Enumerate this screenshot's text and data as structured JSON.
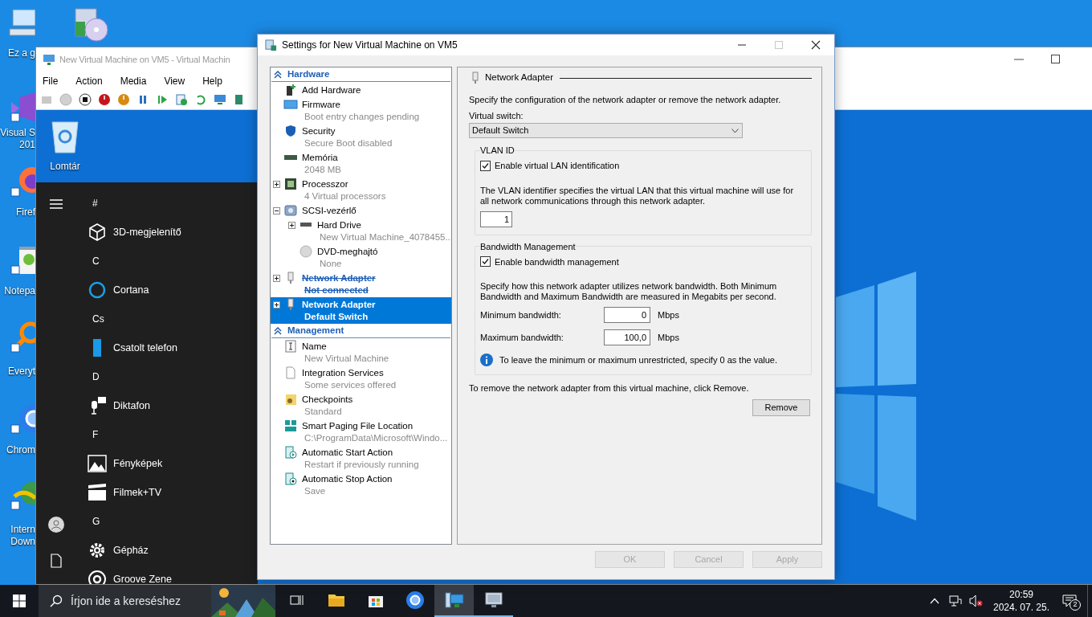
{
  "desktop": {
    "icons": [
      {
        "lines": [
          "Ez a g"
        ]
      },
      {
        "lines": [
          "Visual S",
          "201"
        ]
      },
      {
        "lines": [
          "Firef"
        ]
      },
      {
        "lines": [
          "Notepa"
        ]
      },
      {
        "lines": [
          "Everyt"
        ]
      },
      {
        "lines": [
          "Chrom"
        ]
      },
      {
        "lines": [
          "Intern",
          "Down"
        ]
      }
    ]
  },
  "vm_window": {
    "title": "New Virtual Machine on VM5 - Virtual Machin",
    "menu": [
      "File",
      "Action",
      "Media",
      "View",
      "Help"
    ],
    "guest": {
      "recycle_bin": "Lomtár",
      "start_menu": {
        "items": [
          {
            "kind": "header",
            "label": "#"
          },
          {
            "kind": "app",
            "label": "3D-megjelenítő"
          },
          {
            "kind": "header",
            "label": "C"
          },
          {
            "kind": "app",
            "label": "Cortana"
          },
          {
            "kind": "header",
            "label": "Cs"
          },
          {
            "kind": "app",
            "label": "Csatolt telefon"
          },
          {
            "kind": "header",
            "label": "D"
          },
          {
            "kind": "app",
            "label": "Diktafon"
          },
          {
            "kind": "header",
            "label": "F"
          },
          {
            "kind": "app",
            "label": "Fényképek"
          },
          {
            "kind": "app",
            "label": "Filmek+TV"
          },
          {
            "kind": "header",
            "label": "G"
          },
          {
            "kind": "app",
            "label": "Gépház"
          },
          {
            "kind": "app",
            "label": "Groove Zene"
          }
        ]
      }
    }
  },
  "settings": {
    "title": "Settings for New Virtual Machine on VM5",
    "sections": [
      {
        "label": "Hardware",
        "expanded": true,
        "items": [
          {
            "label": "Add Hardware",
            "selected": false,
            "removed": false
          },
          {
            "label": "Firmware",
            "detail": "Boot entry changes pending",
            "selected": false,
            "removed": false
          },
          {
            "label": "Security",
            "detail": "Secure Boot disabled",
            "selected": false,
            "removed": false
          },
          {
            "label": "Memória",
            "detail": "2048 MB",
            "selected": false,
            "removed": false
          },
          {
            "label": "Processzor",
            "detail": "4 Virtual processors",
            "expanded": false,
            "selected": false,
            "removed": false
          },
          {
            "label": "SCSI-vezérlő",
            "expanded": true,
            "selected": false,
            "removed": false,
            "children": [
              {
                "label": "Hard Drive",
                "detail": "New Virtual Machine_4078455...",
                "expanded": false,
                "selected": false,
                "removed": false
              },
              {
                "label": "DVD-meghajtó",
                "detail": "None",
                "selected": false,
                "removed": false
              }
            ]
          },
          {
            "label": "Network Adapter",
            "detail": "Not connected",
            "expanded": false,
            "selected": false,
            "removed": true
          },
          {
            "label": "Network Adapter",
            "detail": "Default Switch",
            "expanded": false,
            "selected": true,
            "removed": false
          }
        ]
      },
      {
        "label": "Management",
        "expanded": true,
        "items": [
          {
            "label": "Name",
            "detail": "New Virtual Machine",
            "selected": false,
            "removed": false
          },
          {
            "label": "Integration Services",
            "detail": "Some services offered",
            "selected": false,
            "removed": false
          },
          {
            "label": "Checkpoints",
            "detail": "Standard",
            "selected": false,
            "removed": false
          },
          {
            "label": "Smart Paging File Location",
            "detail": "C:\\ProgramData\\Microsoft\\Windo...",
            "selected": false,
            "removed": false
          },
          {
            "label": "Automatic Start Action",
            "detail": "Restart if previously running",
            "selected": false,
            "removed": false
          },
          {
            "label": "Automatic Stop Action",
            "detail": "Save",
            "selected": false,
            "removed": false
          }
        ]
      }
    ],
    "panel": {
      "heading": "Network Adapter",
      "intro": "Specify the configuration of the network adapter or remove the network adapter.",
      "switch_label": "Virtual switch:",
      "switch_value": "Default Switch",
      "vlan": {
        "legend": "VLAN ID",
        "checkbox": {
          "label": "Enable virtual LAN identification",
          "checked": true
        },
        "description": "The VLAN identifier specifies the virtual LAN that this virtual machine will use for all network communications through this network adapter.",
        "value": "1"
      },
      "bandwidth": {
        "legend": "Bandwidth Management",
        "checkbox": {
          "label": "Enable bandwidth management",
          "checked": true
        },
        "description": "Specify how this network adapter utilizes network bandwidth. Both Minimum Bandwidth and Maximum Bandwidth are measured in Megabits per second.",
        "fields": [
          {
            "label": "Minimum bandwidth:",
            "value": "0",
            "unit": "Mbps"
          },
          {
            "label": "Maximum bandwidth:",
            "value": "100,0",
            "unit": "Mbps"
          }
        ],
        "info": "To leave the minimum or maximum unrestricted, specify 0 as the value."
      },
      "remove_text": "To remove the network adapter from this virtual machine, click Remove.",
      "remove_button": "Remove"
    },
    "buttons": [
      {
        "label": "OK",
        "disabled": true
      },
      {
        "label": "Cancel",
        "disabled": true
      },
      {
        "label": "Apply",
        "disabled": true
      }
    ]
  },
  "taskbar": {
    "search": {
      "placeholder": "Írjon ide a kereséshez"
    },
    "apps": [
      {
        "selected": false,
        "running": false
      },
      {
        "selected": false,
        "running": false
      },
      {
        "selected": false,
        "running": false
      },
      {
        "selected": false,
        "running": false
      },
      {
        "selected": true,
        "running": true
      },
      {
        "selected": false,
        "running": true
      }
    ],
    "time": "20:59",
    "date": "2024. 07. 25.",
    "notifications": "2"
  }
}
